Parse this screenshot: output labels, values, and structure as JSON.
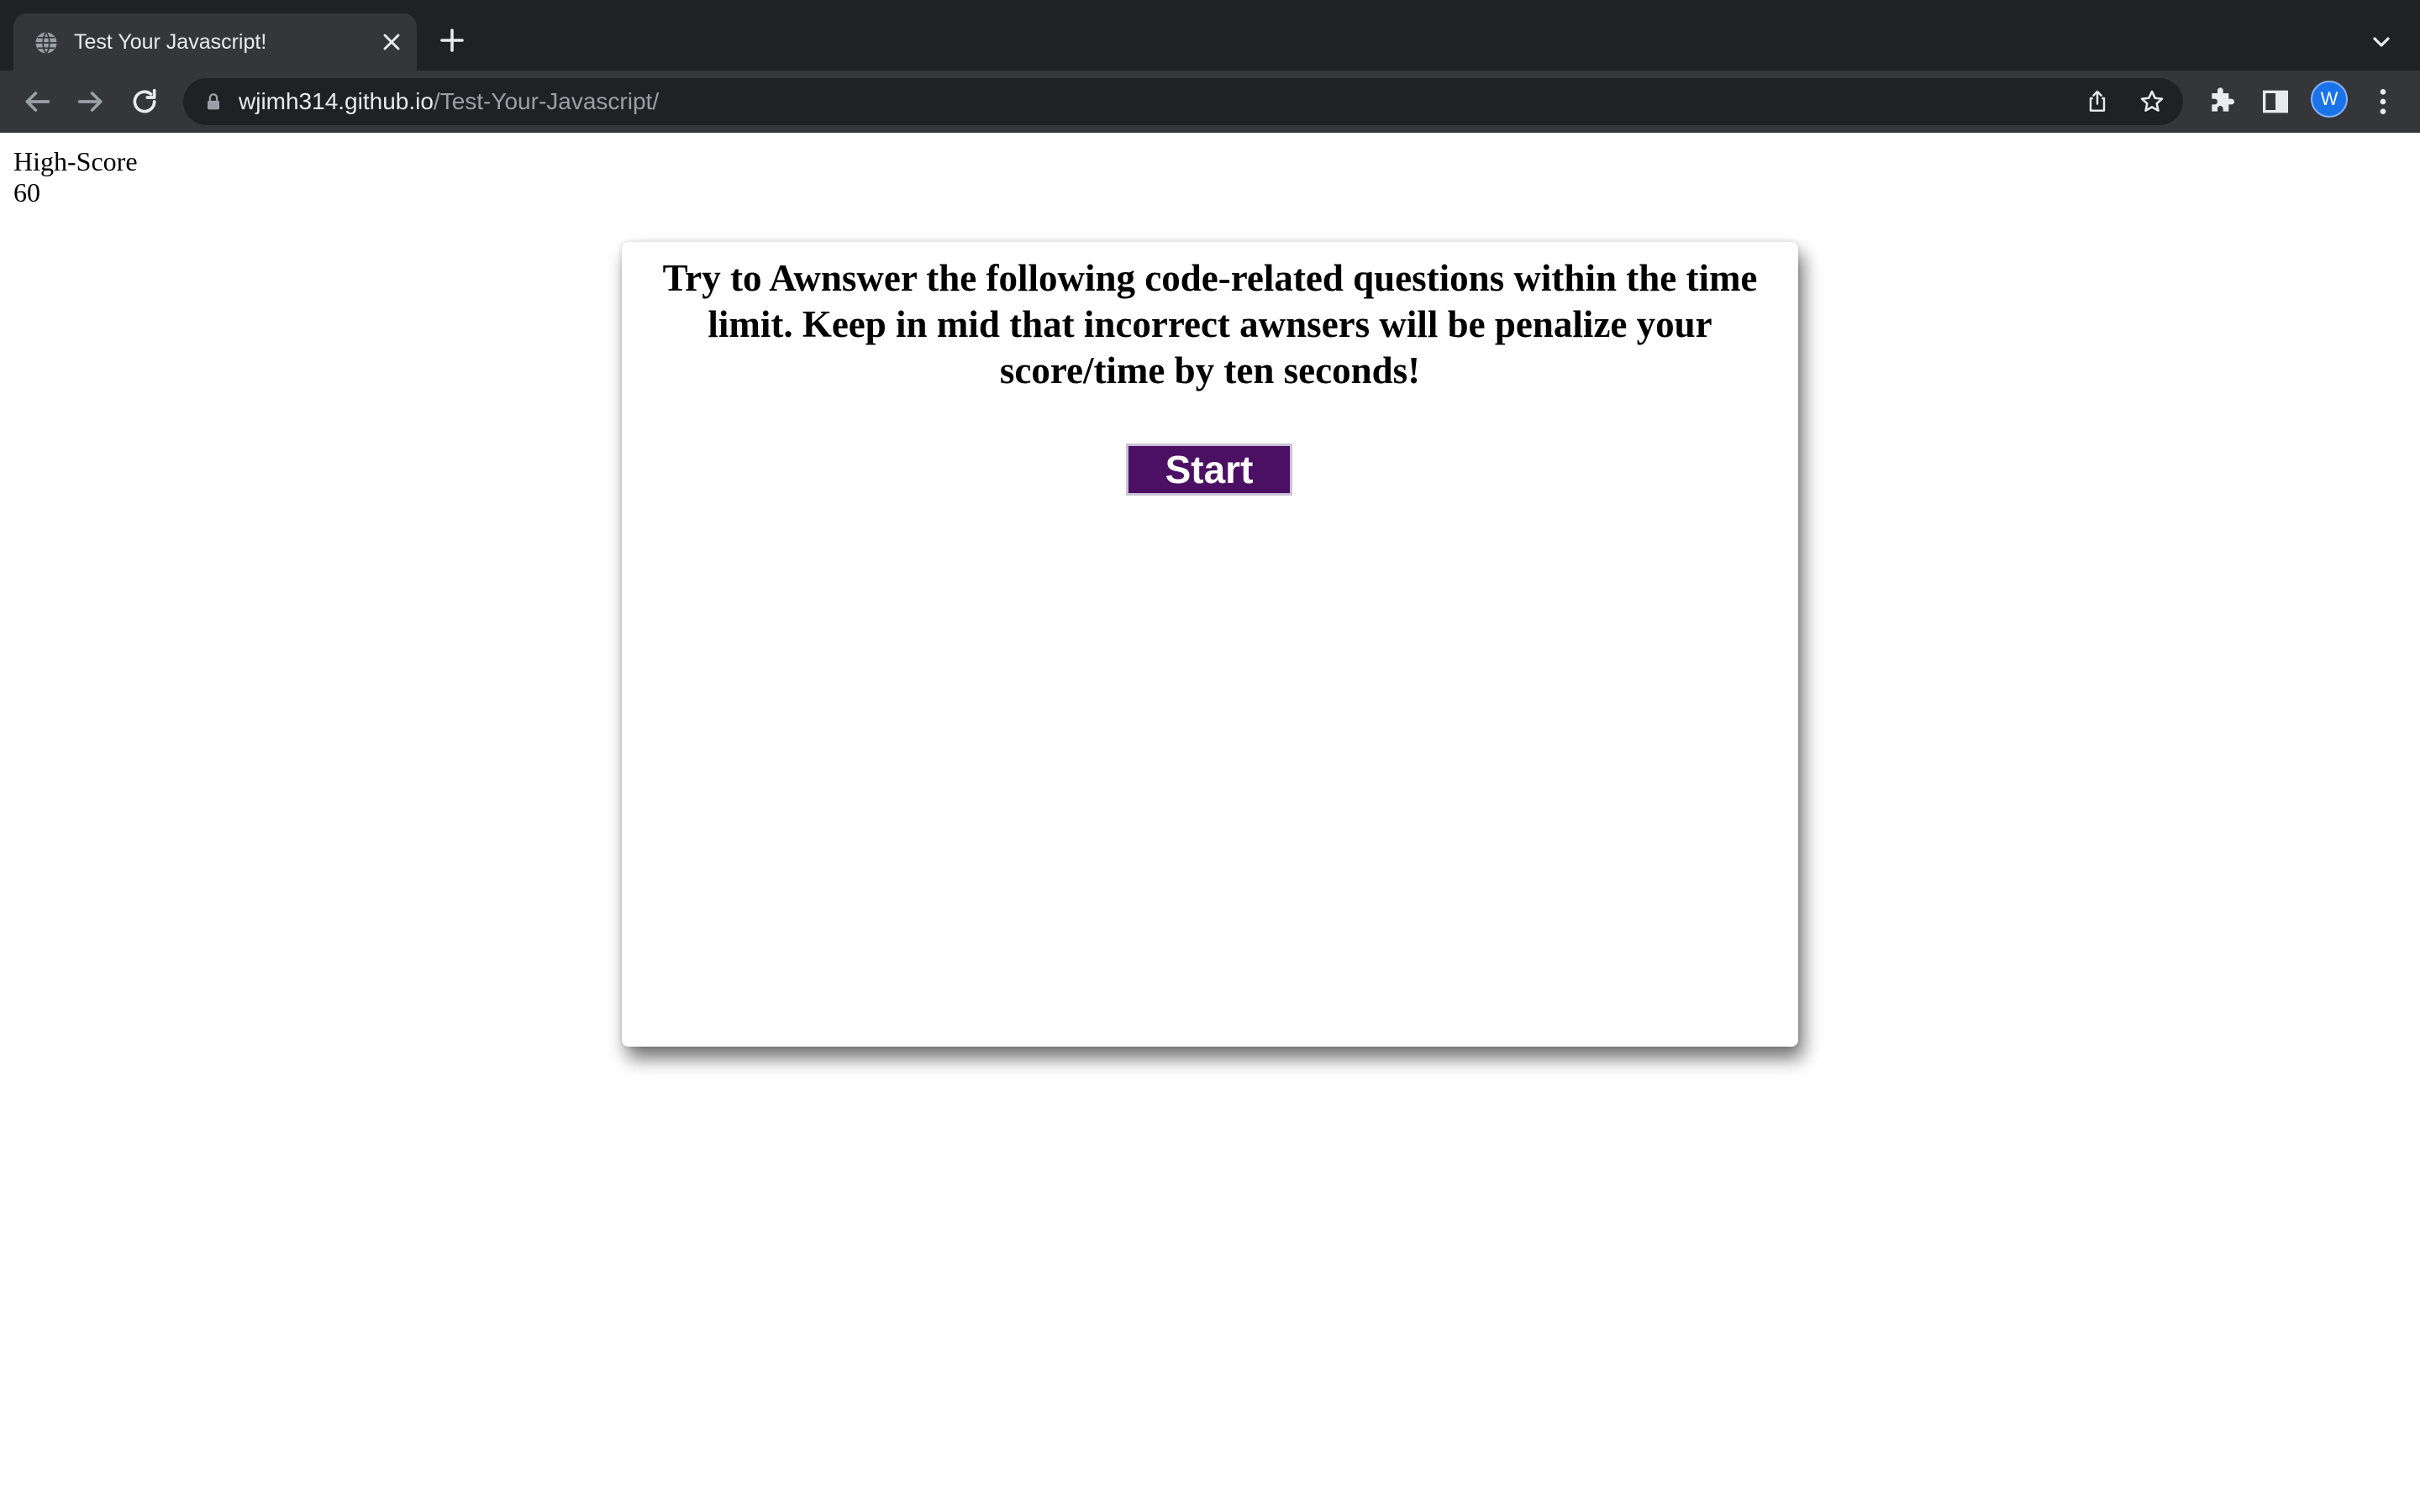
{
  "browser": {
    "tab": {
      "title": "Test Your Javascript!",
      "favicon": "globe-icon"
    },
    "address": {
      "host": "wjimh314.github.io",
      "path": "/Test-Your-Javascript/"
    },
    "profile_initial": "W",
    "icons": [
      "back-icon",
      "forward-icon",
      "reload-icon",
      "lock-icon",
      "share-icon",
      "bookmark-star-icon",
      "extensions-icon",
      "side-panel-icon",
      "menu-icon",
      "new-tab-icon",
      "tab-search-icon",
      "close-icon"
    ],
    "colors": {
      "frame": "#202124",
      "toolbar": "#35363a",
      "avatar": "#1a73e8"
    }
  },
  "page": {
    "highscore_label": "High-Score",
    "highscore_value": "60",
    "instructions": "Try to Awnswer the following code-related questions within the time limit. Keep in mid that incorrect awnsers will be penalize your score/time by ten seconds!",
    "start_label": "Start",
    "colors": {
      "start_button_bg": "#4b0f63",
      "start_button_text": "#ffffff"
    }
  }
}
